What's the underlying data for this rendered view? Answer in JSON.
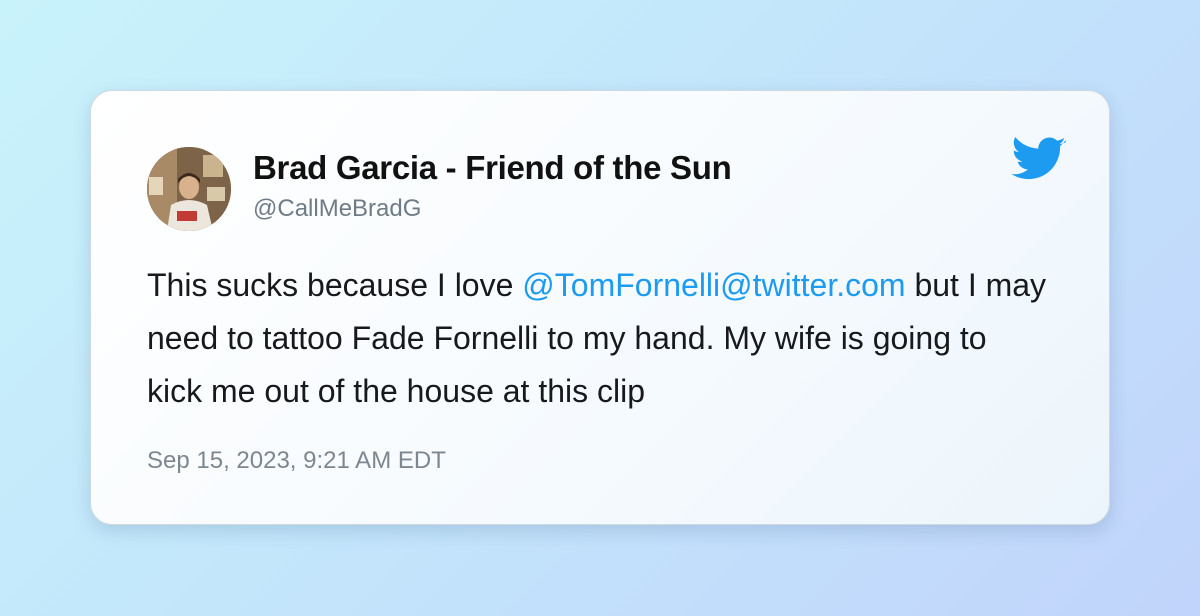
{
  "tweet": {
    "author_name": "Brad Garcia - Friend of the Sun",
    "author_handle": "@CallMeBradG",
    "text_before": "This sucks because I love ",
    "mention": "@TomFornelli@twitter.com",
    "text_after": " but I may need to tattoo Fade Fornelli to my hand. My wife is going to kick me out of the house at this clip",
    "timestamp": "Sep 15, 2023, 9:21 AM EDT"
  },
  "icons": {
    "brand": "twitter-bird-icon",
    "avatar": "profile-photo"
  },
  "colors": {
    "mention": "#1d9bf0",
    "brand": "#1d9bf0",
    "text": "#17191c",
    "secondary": "#6f7c87"
  }
}
